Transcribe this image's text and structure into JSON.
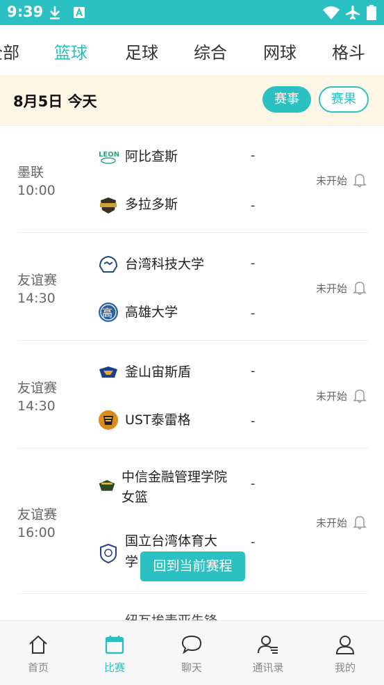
{
  "status_bar": {
    "time": "9:39",
    "icons": [
      "download-icon",
      "a-badge-icon",
      "wifi-icon",
      "airplane-icon",
      "battery-icon"
    ]
  },
  "tabs": [
    {
      "label": "全部",
      "active": false
    },
    {
      "label": "篮球",
      "active": true
    },
    {
      "label": "足球",
      "active": false
    },
    {
      "label": "综合",
      "active": false
    },
    {
      "label": "网球",
      "active": false
    },
    {
      "label": "格斗",
      "active": false
    }
  ],
  "date_bar": {
    "date": "8月5日 今天",
    "events_label": "赛事",
    "results_label": "赛果"
  },
  "matches": [
    {
      "league": "墨联",
      "time": "10:00",
      "home": "阿比查斯",
      "away": "多拉多斯",
      "home_score": "-",
      "away_score": "-",
      "status": "未开始"
    },
    {
      "league": "友谊赛",
      "time": "14:30",
      "home": "台湾科技大学",
      "away": "高雄大学",
      "home_score": "-",
      "away_score": "-",
      "status": "未开始"
    },
    {
      "league": "友谊赛",
      "time": "14:30",
      "home": "釜山宙斯盾",
      "away": "UST泰雷格",
      "home_score": "-",
      "away_score": "-",
      "status": "未开始"
    },
    {
      "league": "友谊赛",
      "time": "16:00",
      "home_line1": "中信金融管理学院",
      "home_line2": "女篮",
      "away_line1": "国立台湾体育大",
      "away_line2": "学",
      "home_score": "-",
      "away_score": "-",
      "status": "未开始"
    },
    {
      "partial_name": "纽瓦埃麦亚先锋"
    }
  ],
  "back_to_current": "回到当前赛程",
  "bottom_nav": [
    {
      "label": "首页",
      "icon": "home-icon",
      "active": false
    },
    {
      "label": "比赛",
      "icon": "calendar-icon",
      "active": true
    },
    {
      "label": "聊天",
      "icon": "chat-bubble-icon",
      "active": false
    },
    {
      "label": "通讯录",
      "icon": "contacts-icon",
      "active": false
    },
    {
      "label": "我的",
      "icon": "user-icon",
      "active": false
    }
  ],
  "colors": {
    "accent": "#2bc0c2",
    "date_bar_bg": "#fdf6e4"
  }
}
